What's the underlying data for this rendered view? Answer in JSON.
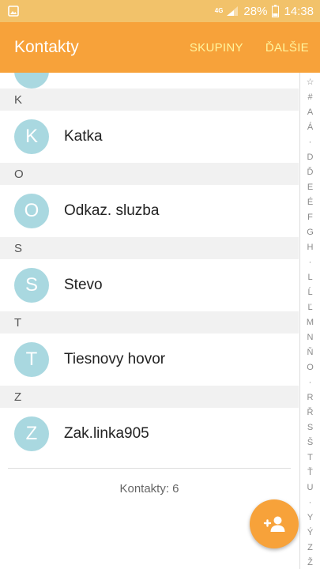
{
  "status_bar": {
    "network": "4G",
    "battery": "28%",
    "time": "14:38"
  },
  "app_bar": {
    "title": "Kontakty",
    "actions": [
      "SKUPINY",
      "ĎALŠIE"
    ]
  },
  "sections": [
    {
      "letter": "K",
      "contacts": [
        {
          "initial": "K",
          "name": "Katka"
        }
      ]
    },
    {
      "letter": "O",
      "contacts": [
        {
          "initial": "O",
          "name": "Odkaz. sluzba"
        }
      ]
    },
    {
      "letter": "S",
      "contacts": [
        {
          "initial": "S",
          "name": "Stevo"
        }
      ]
    },
    {
      "letter": "T",
      "contacts": [
        {
          "initial": "T",
          "name": "Tiesnovy hovor"
        }
      ]
    },
    {
      "letter": "Z",
      "contacts": [
        {
          "initial": "Z",
          "name": "Zak.linka905"
        }
      ]
    }
  ],
  "contact_count": "Kontakty: 6",
  "index_letters": [
    "☆",
    "#",
    "A",
    "Á",
    "·",
    "D",
    "Ď",
    "E",
    "É",
    "F",
    "G",
    "H",
    "·",
    "L",
    "Ĺ",
    "Ľ",
    "M",
    "N",
    "Ň",
    "O",
    "·",
    "R",
    "Ř",
    "S",
    "Š",
    "T",
    "Ť",
    "U",
    "·",
    "Y",
    "Ý",
    "Z",
    "Ž"
  ],
  "icons": {
    "status_left": "gallery-icon",
    "signal": "signal-icon",
    "battery": "battery-icon",
    "fab": "add-contact-icon"
  },
  "colors": {
    "app_bar": "#f7a23a",
    "status_bar": "#f2c26a",
    "action_text": "#fff59e",
    "avatar": "#a9d8e0",
    "section_bg": "#f1f1f1"
  }
}
